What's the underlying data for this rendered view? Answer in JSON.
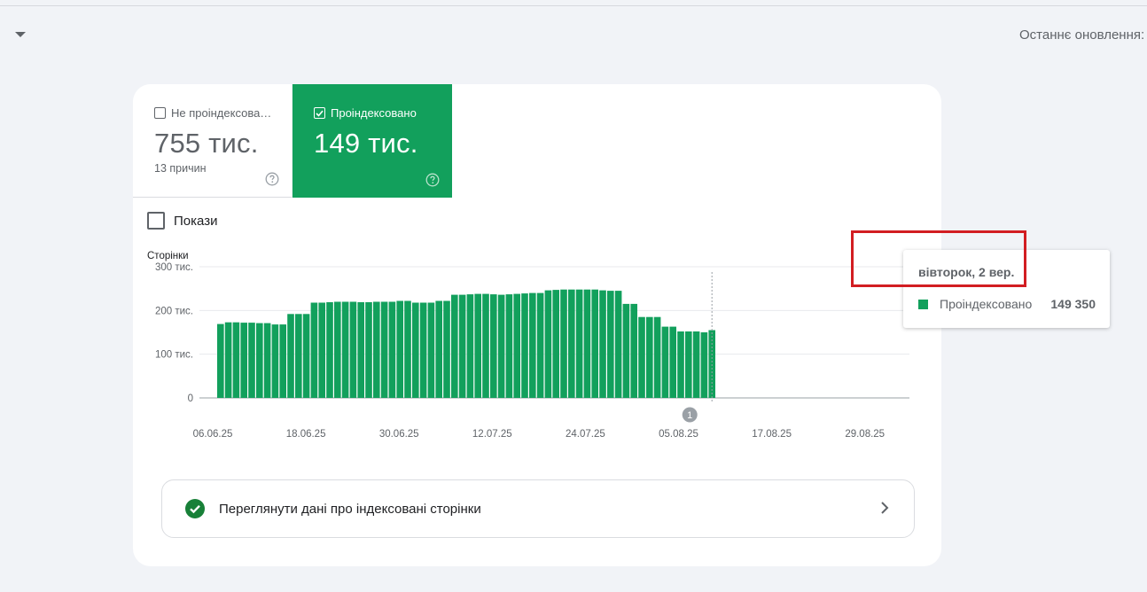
{
  "header": {
    "last_update_label": "Останнє оновлення:"
  },
  "tiles": {
    "not_indexed": {
      "label": "Не проіндексова…",
      "value": "755 тис.",
      "sub": "13 причин"
    },
    "indexed": {
      "label": "Проіндексовано",
      "value": "149 тис."
    }
  },
  "impressions": {
    "label": "Покази"
  },
  "chart_data": {
    "type": "bar",
    "ylabel": "Сторінки",
    "ylim": [
      0,
      300000
    ],
    "yticks": [
      {
        "value": 0,
        "label": "0"
      },
      {
        "value": 100000,
        "label": "100 тис."
      },
      {
        "value": 200000,
        "label": "200 тис."
      },
      {
        "value": 300000,
        "label": "300 тис."
      }
    ],
    "xtick_labels": [
      "06.06.25",
      "18.06.25",
      "30.06.25",
      "12.07.25",
      "24.07.25",
      "05.08.25",
      "17.08.25",
      "29.08.25"
    ],
    "series": [
      {
        "name": "Проіндексовано",
        "color": "#12a05c",
        "values": [
          169000,
          173000,
          173000,
          172000,
          172000,
          171000,
          171000,
          168000,
          168000,
          192000,
          192000,
          192000,
          218000,
          218000,
          219000,
          220000,
          220000,
          220000,
          219000,
          219000,
          220000,
          220000,
          220000,
          222000,
          222000,
          218000,
          218000,
          218000,
          222000,
          222000,
          236000,
          236000,
          237000,
          238000,
          238000,
          237000,
          236000,
          237000,
          238000,
          239000,
          240000,
          240000,
          246000,
          247000,
          248000,
          248000,
          248000,
          248000,
          248000,
          246000,
          245000,
          245000,
          215000,
          215000,
          185000,
          185000,
          185000,
          163000,
          163000,
          152000,
          152000,
          152000,
          150000,
          155000
        ]
      }
    ],
    "annotation_badge": "1",
    "grid": true
  },
  "tooltip": {
    "date": "вівторок, 2 вер.",
    "series_name": "Проіндексовано",
    "value": "149 350"
  },
  "link_row": {
    "label": "Переглянути дані про індексовані сторінки"
  }
}
